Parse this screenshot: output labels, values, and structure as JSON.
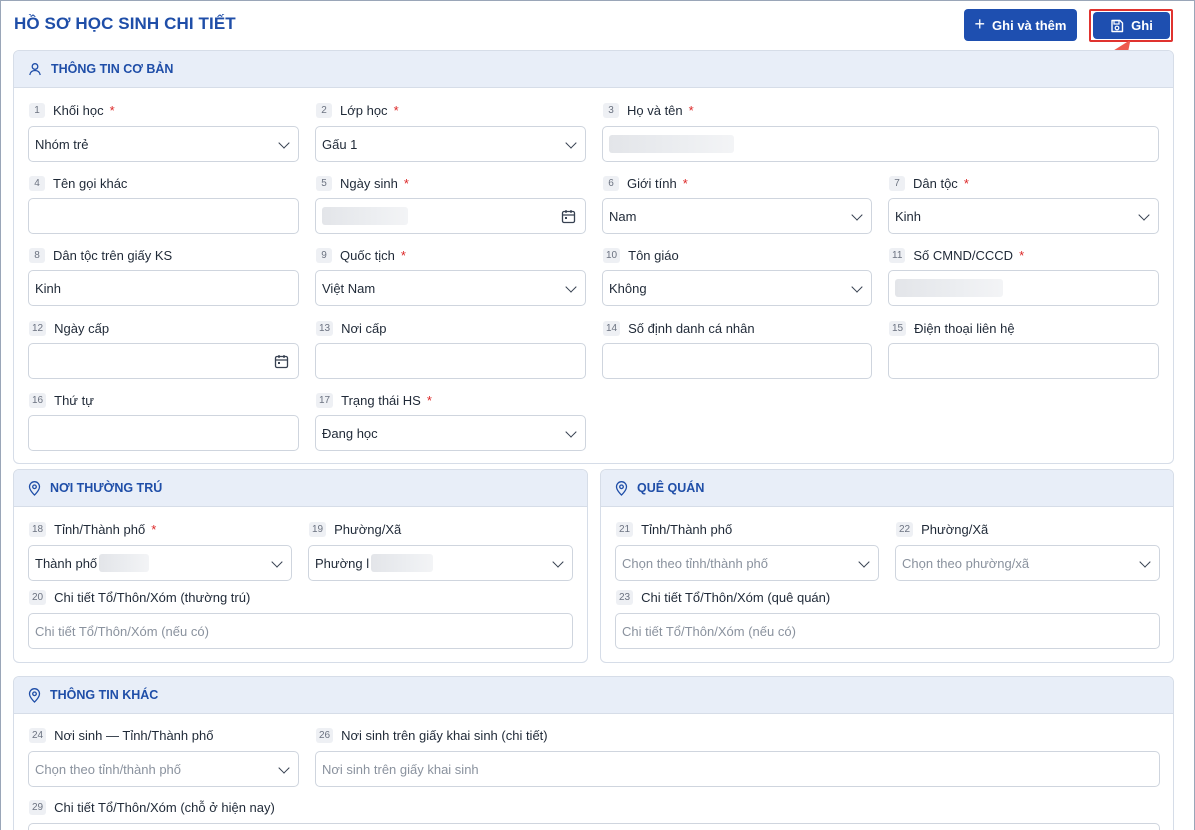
{
  "page": {
    "title": "HỒ SƠ HỌC SINH CHI TIẾT"
  },
  "toolbar": {
    "add_label": "Ghi và thêm",
    "save_label": "Ghi"
  },
  "sections": {
    "basic": {
      "title": "THÔNG TIN CƠ BẢN"
    },
    "residence": {
      "title": "NƠI THƯỜNG TRÚ"
    },
    "hometown": {
      "title": "QUÊ QUÁN"
    },
    "other": {
      "title": "THÔNG TIN KHÁC"
    }
  },
  "fields": {
    "f1": {
      "num": "1",
      "label": "Khối học",
      "required": "*",
      "value": "Nhóm trẻ"
    },
    "f2": {
      "num": "2",
      "label": "Lớp học",
      "required": "*",
      "value": "Gấu 1"
    },
    "f3": {
      "num": "3",
      "label": "Họ và tên",
      "required": "*"
    },
    "f4": {
      "num": "4",
      "label": "Tên gọi khác"
    },
    "f5": {
      "num": "5",
      "label": "Ngày sinh",
      "required": "*"
    },
    "f6": {
      "num": "6",
      "label": "Giới tính",
      "required": "*",
      "value": "Nam"
    },
    "f7": {
      "num": "7",
      "label": "Dân tộc",
      "required": "*",
      "value": "Kinh"
    },
    "f8": {
      "num": "8",
      "label": "Dân tộc trên giấy KS",
      "value": "Kinh"
    },
    "f9": {
      "num": "9",
      "label": "Quốc tịch",
      "required": "*",
      "value": "Việt Nam"
    },
    "f10": {
      "num": "10",
      "label": "Tôn giáo",
      "value": "Không"
    },
    "f11": {
      "num": "11",
      "label": "Số CMND/CCCD",
      "required": "*"
    },
    "f12": {
      "num": "12",
      "label": "Ngày cấp"
    },
    "f13": {
      "num": "13",
      "label": "Nơi cấp"
    },
    "f14": {
      "num": "14",
      "label": "Số định danh cá nhân"
    },
    "f15": {
      "num": "15",
      "label": "Điện thoại liên hệ"
    },
    "f16": {
      "num": "16",
      "label": "Thứ tự"
    },
    "f17": {
      "num": "17",
      "label": "Trạng thái HS",
      "required": "*",
      "value": "Đang học"
    },
    "f18": {
      "num": "18",
      "label": "Tỉnh/Thành phố",
      "required": "*",
      "value": "Thành phố"
    },
    "f19": {
      "num": "19",
      "label": "Phường/Xã",
      "value": "Phường l"
    },
    "f20": {
      "num": "20",
      "label": "Chi tiết Tổ/Thôn/Xóm (thường trú)",
      "placeholder": "Chi tiết Tổ/Thôn/Xóm (nếu có)"
    },
    "f21": {
      "num": "21",
      "label": "Tỉnh/Thành phố",
      "placeholder": "Chọn theo tỉnh/thành phố"
    },
    "f22": {
      "num": "22",
      "label": "Phường/Xã",
      "placeholder": "Chọn theo phường/xã"
    },
    "f23": {
      "num": "23",
      "label": "Chi tiết Tổ/Thôn/Xóm (quê quán)",
      "placeholder": "Chi tiết Tổ/Thôn/Xóm (nếu có)"
    },
    "f24": {
      "num": "24",
      "label": "Nơi sinh — Tỉnh/Thành phố",
      "placeholder": "Chọn theo tỉnh/thành phố"
    },
    "f26": {
      "num": "26",
      "label": "Nơi sinh trên giấy khai sinh (chi tiết)",
      "placeholder": "Nơi sinh trên giấy khai sinh"
    },
    "f29": {
      "num": "29",
      "label": "Chi tiết Tổ/Thôn/Xóm (chỗ ở hiện nay)"
    }
  },
  "colors": {
    "accent": "#1e4fb0",
    "title": "#1f4ea8",
    "highlight": "#e0332f",
    "arrow": "#ee5a4f",
    "required": "#dc2626"
  }
}
